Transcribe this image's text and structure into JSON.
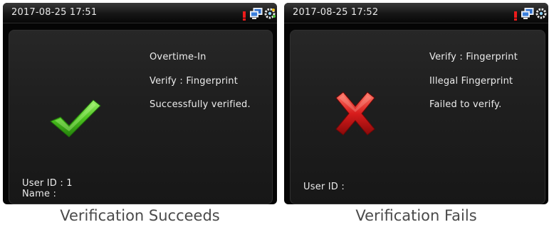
{
  "left_screen": {
    "datetime": "2017-08-25 17:51",
    "lines": [
      "Overtime-In",
      "Verify : Fingerprint",
      "Successfully verified."
    ],
    "user_id": "User ID : 1",
    "name": "Name :",
    "result_icon": "check-icon"
  },
  "right_screen": {
    "datetime": "2017-08-25 17:52",
    "lines": [
      "Verify : Fingerprint",
      "Illegal Fingerprint",
      "Failed to verify."
    ],
    "user_id": "User ID :",
    "result_icon": "cross-icon"
  },
  "captions": {
    "left": "Verification Succeeds",
    "right": "Verification Fails"
  },
  "colors": {
    "success": "#4cc21f",
    "failure": "#d81c1c",
    "alarm": "#ee1b1b"
  }
}
